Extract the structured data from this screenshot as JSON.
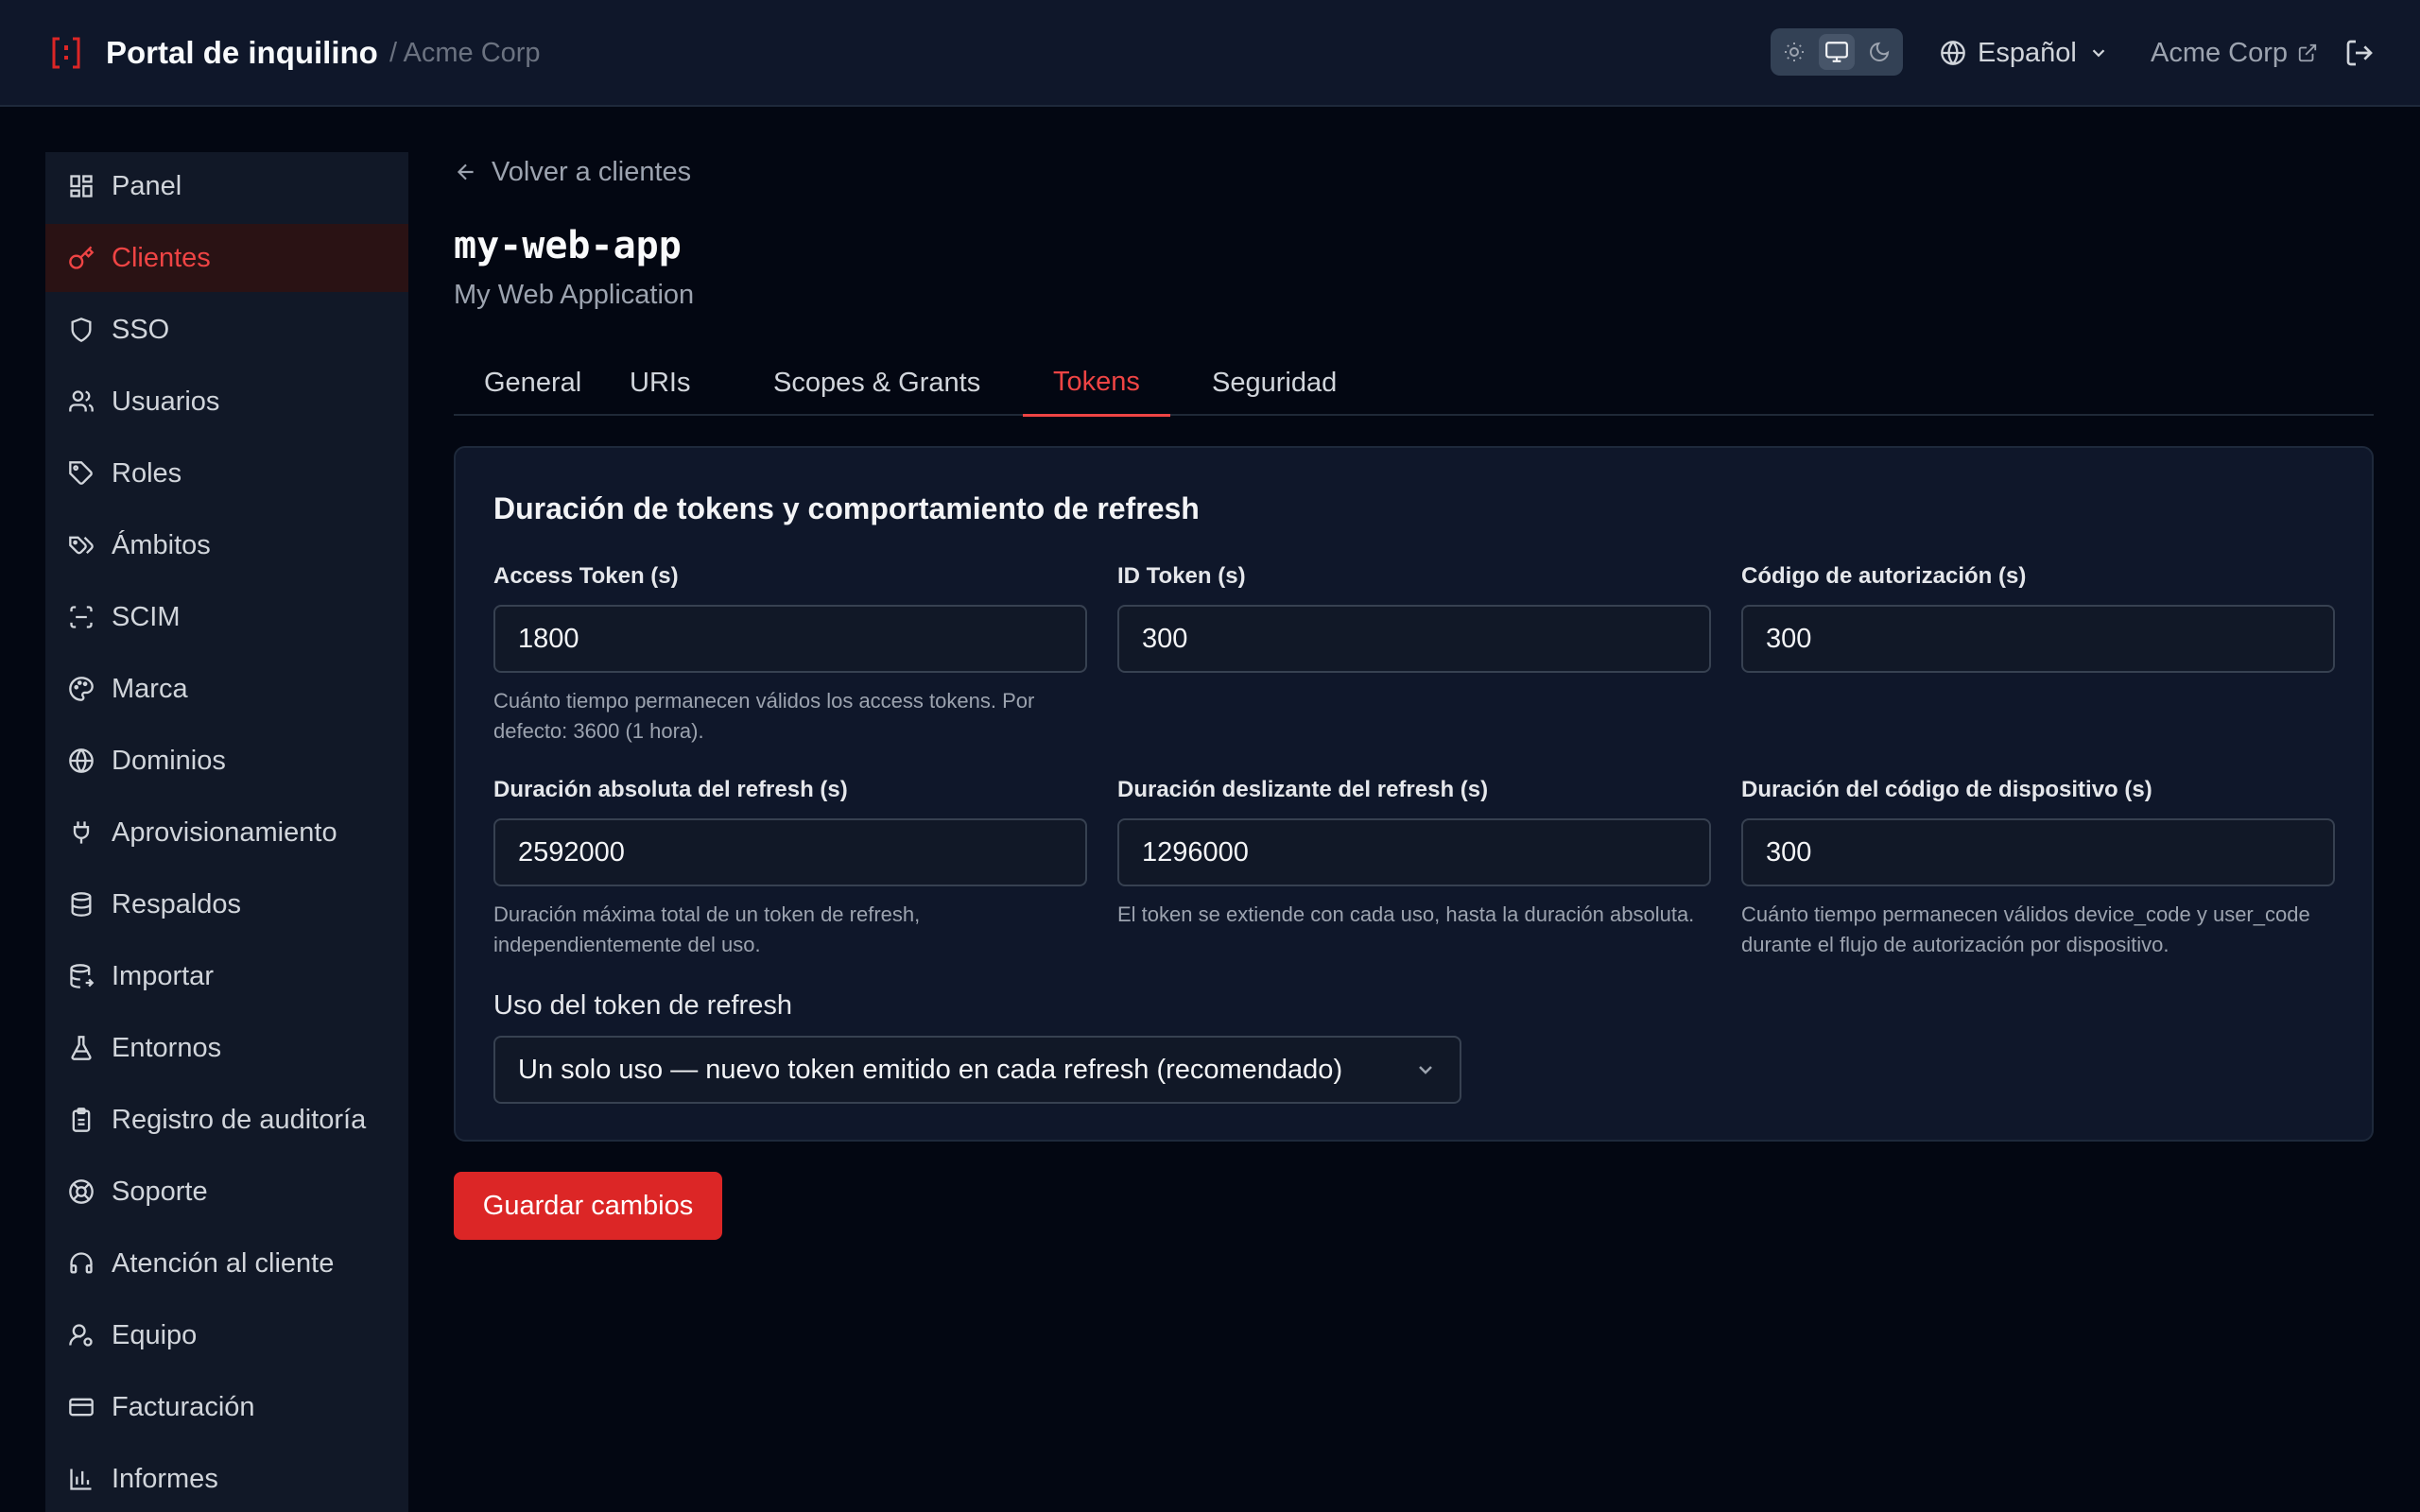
{
  "header": {
    "title": "Portal de inquilino",
    "tenant_breadcrumb": "/ Acme Corp",
    "language": "Español",
    "tenant_name": "Acme Corp"
  },
  "sidebar": {
    "items": [
      {
        "label": "Panel",
        "icon": "dashboard-icon"
      },
      {
        "label": "Clientes",
        "icon": "key-icon"
      },
      {
        "label": "SSO",
        "icon": "shield-icon"
      },
      {
        "label": "Usuarios",
        "icon": "users-icon"
      },
      {
        "label": "Roles",
        "icon": "tag-icon"
      },
      {
        "label": "Ámbitos",
        "icon": "tags-icon"
      },
      {
        "label": "SCIM",
        "icon": "scan-icon"
      },
      {
        "label": "Marca",
        "icon": "palette-icon"
      },
      {
        "label": "Dominios",
        "icon": "globe-icon"
      },
      {
        "label": "Aprovisionamiento",
        "icon": "plug-icon"
      },
      {
        "label": "Respaldos",
        "icon": "database-icon"
      },
      {
        "label": "Importar",
        "icon": "database-import-icon"
      },
      {
        "label": "Entornos",
        "icon": "flask-icon"
      },
      {
        "label": "Registro de auditoría",
        "icon": "clipboard-icon"
      },
      {
        "label": "Soporte",
        "icon": "lifebuoy-icon"
      },
      {
        "label": "Atención al cliente",
        "icon": "headset-icon"
      },
      {
        "label": "Equipo",
        "icon": "user-gear-icon"
      },
      {
        "label": "Facturación",
        "icon": "credit-card-icon"
      },
      {
        "label": "Informes",
        "icon": "bar-chart-icon"
      }
    ],
    "active_index": 1
  },
  "main": {
    "back_label": "Volver a clientes",
    "client_id": "my-web-app",
    "client_name": "My Web Application",
    "tabs": [
      {
        "label": "General"
      },
      {
        "label": "URIs"
      },
      {
        "label": "Scopes & Grants"
      },
      {
        "label": "Tokens"
      },
      {
        "label": "Seguridad"
      }
    ],
    "active_tab": 3,
    "card": {
      "title": "Duración de tokens y comportamiento de refresh",
      "fields": [
        {
          "label": "Access Token (s)",
          "value": "1800",
          "help": "Cuánto tiempo permanecen válidos los access tokens. Por defecto: 3600 (1 hora)."
        },
        {
          "label": "ID Token (s)",
          "value": "300",
          "help": ""
        },
        {
          "label": "Código de autorización (s)",
          "value": "300",
          "help": ""
        },
        {
          "label": "Duración absoluta del refresh (s)",
          "value": "2592000",
          "help": "Duración máxima total de un token de refresh, independientemente del uso."
        },
        {
          "label": "Duración deslizante del refresh (s)",
          "value": "1296000",
          "help": "El token se extiende con cada uso, hasta la duración absoluta."
        },
        {
          "label": "Duración del código de dispositivo (s)",
          "value": "300",
          "help": "Cuánto tiempo permanecen válidos device_code y user_code durante el flujo de autorización por dispositivo."
        }
      ],
      "refresh_usage_label": "Uso del token de refresh",
      "refresh_usage_value": "Un solo uso — nuevo token emitido en cada refresh (recomendado)"
    },
    "save_label": "Guardar cambios"
  },
  "colors": {
    "accent": "#dc2626",
    "accent_text": "#ef4444",
    "background": "#030712",
    "surface": "#0f172a"
  }
}
